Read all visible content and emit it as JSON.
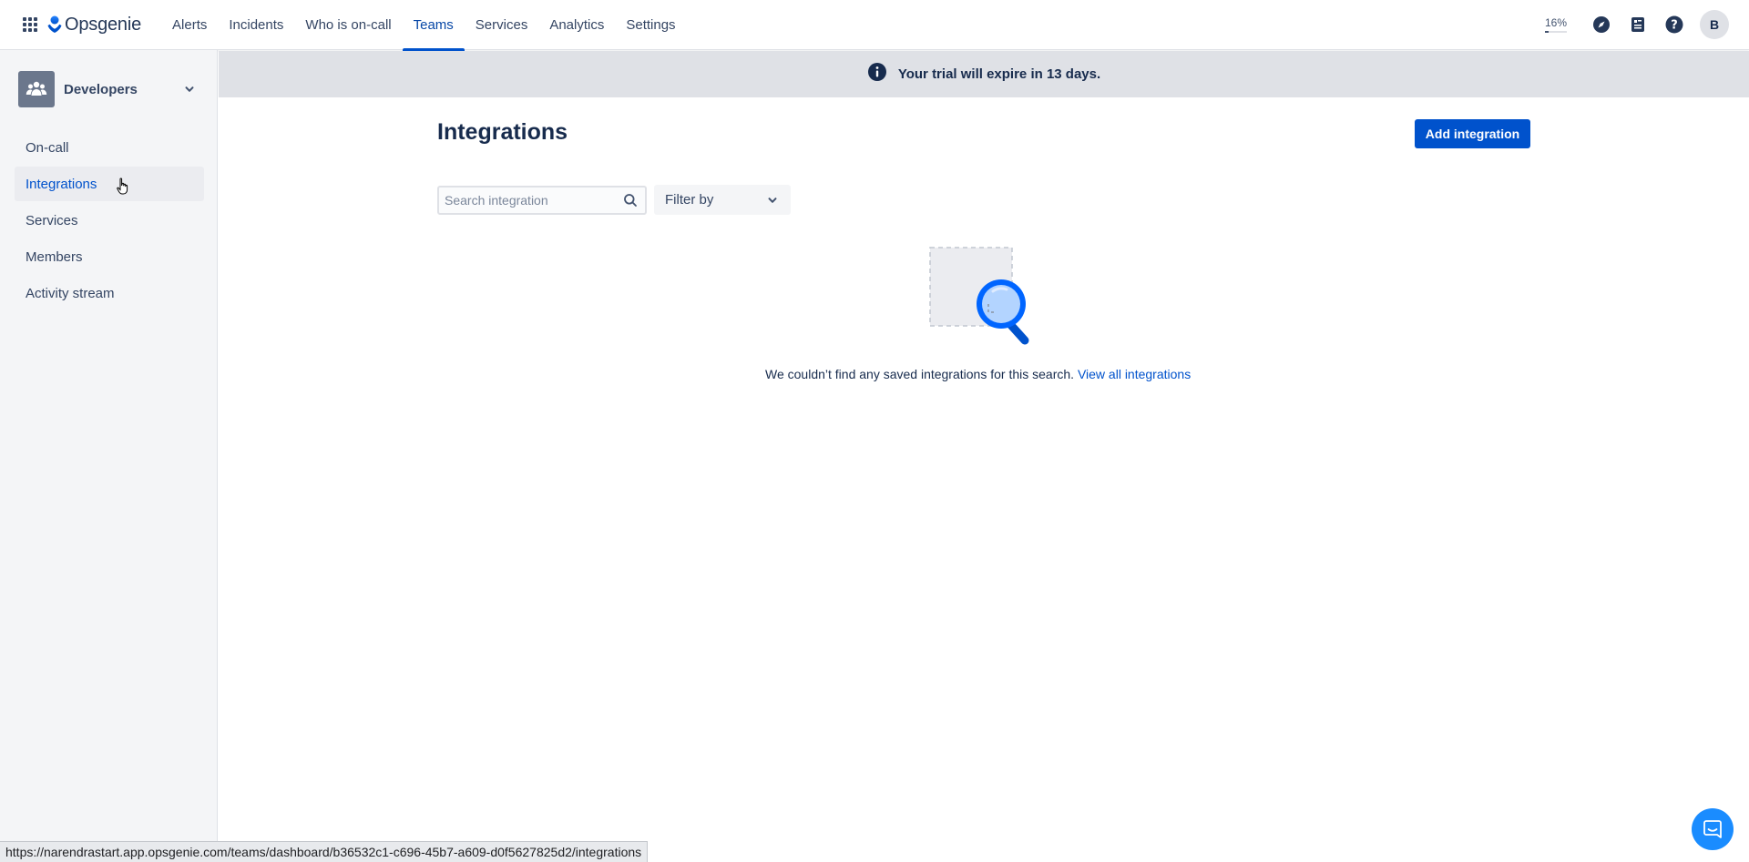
{
  "app": {
    "name": "Opsgenie",
    "brand_color": "#0052cc"
  },
  "topnav": {
    "items": [
      {
        "label": "Alerts",
        "active": false
      },
      {
        "label": "Incidents",
        "active": false
      },
      {
        "label": "Who is on-call",
        "active": false
      },
      {
        "label": "Teams",
        "active": true
      },
      {
        "label": "Services",
        "active": false
      },
      {
        "label": "Analytics",
        "active": false
      },
      {
        "label": "Settings",
        "active": false
      }
    ],
    "usage_label": "16%",
    "usage_fraction": 0.16,
    "icons": [
      "apps-grid-icon",
      "compass-icon",
      "book-icon",
      "help-icon"
    ],
    "avatar_initial": "B"
  },
  "sidebar": {
    "team_name": "Developers",
    "items": [
      {
        "label": "On-call",
        "active": false
      },
      {
        "label": "Integrations",
        "active": true
      },
      {
        "label": "Services",
        "active": false
      },
      {
        "label": "Members",
        "active": false
      },
      {
        "label": "Activity stream",
        "active": false
      }
    ]
  },
  "banner": {
    "text": "Your trial will expire in 13 days."
  },
  "main": {
    "title": "Integrations",
    "add_button_label": "Add integration",
    "search_placeholder": "Search integration",
    "filter_label": "Filter by",
    "empty_message": "We couldn’t find any saved integrations for this search.",
    "empty_link": "View all integrations"
  },
  "status_bar": {
    "url": "https://narendrastart.app.opsgenie.com/teams/dashboard/b36532c1-c696-45b7-a609-d0f5627825d2/integrations"
  }
}
